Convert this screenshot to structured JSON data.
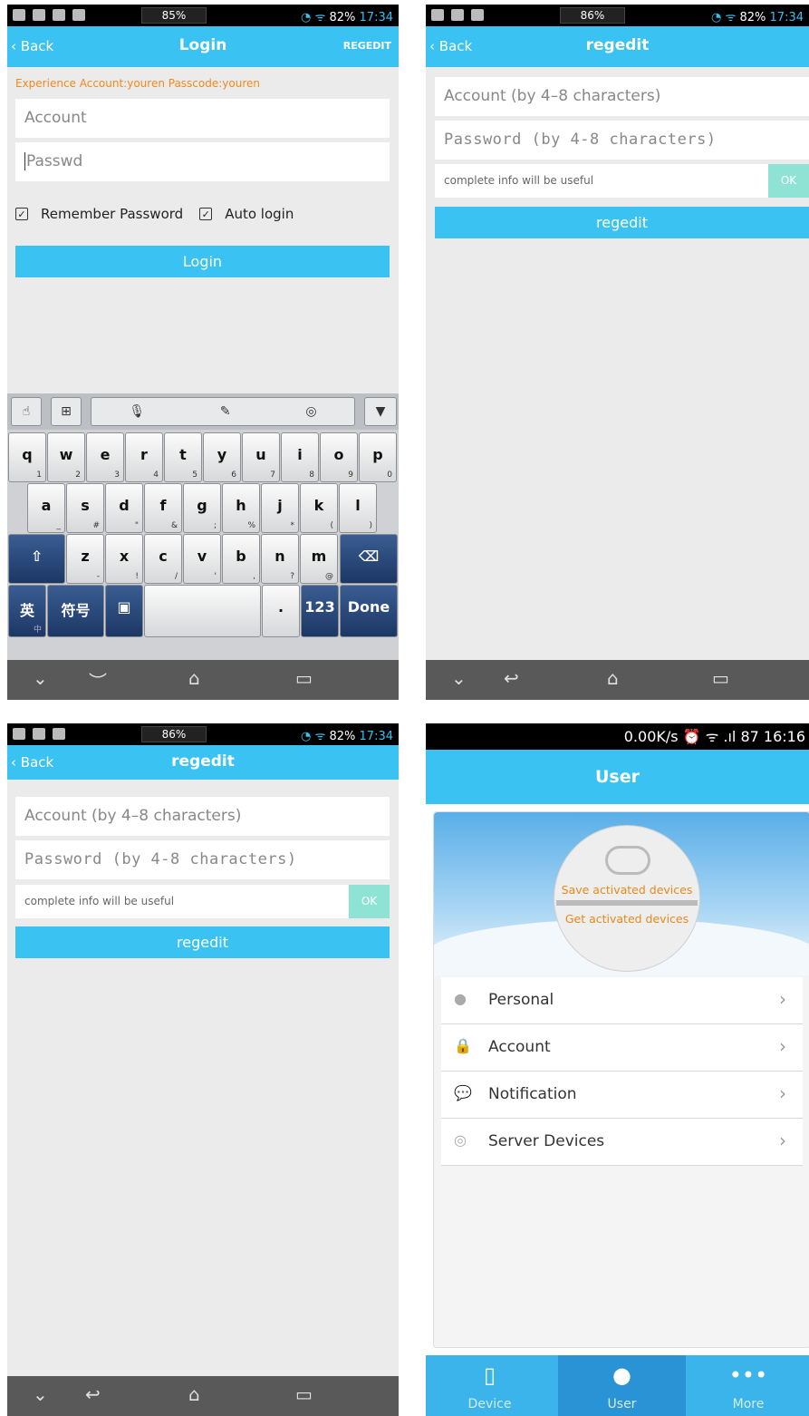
{
  "panel1": {
    "status": {
      "battery": "85%",
      "right": "82%",
      "time": "17:34"
    },
    "back": "Back",
    "title": "Login",
    "right_action": "REGEDIT",
    "hint": "Experience Account:youren Passcode:youren",
    "account_placeholder": "Account",
    "password_placeholder": "Passwd",
    "remember": "Remember Password",
    "autologin": "Auto login",
    "login_button": "Login",
    "keyboard": {
      "row1": [
        {
          "k": "q",
          "s": "1"
        },
        {
          "k": "w",
          "s": "2"
        },
        {
          "k": "e",
          "s": "3"
        },
        {
          "k": "r",
          "s": "4"
        },
        {
          "k": "t",
          "s": "5"
        },
        {
          "k": "y",
          "s": "6"
        },
        {
          "k": "u",
          "s": "7"
        },
        {
          "k": "i",
          "s": "8"
        },
        {
          "k": "o",
          "s": "9"
        },
        {
          "k": "p",
          "s": "0"
        }
      ],
      "row2": [
        {
          "k": "a",
          "s": "_"
        },
        {
          "k": "s",
          "s": "#"
        },
        {
          "k": "d",
          "s": "\""
        },
        {
          "k": "f",
          "s": "&"
        },
        {
          "k": "g",
          "s": ";"
        },
        {
          "k": "h",
          "s": "%"
        },
        {
          "k": "j",
          "s": "*"
        },
        {
          "k": "k",
          "s": "("
        },
        {
          "k": "l",
          "s": ")"
        }
      ],
      "row3": [
        {
          "k": "z",
          "s": "-"
        },
        {
          "k": "x",
          "s": "!"
        },
        {
          "k": "c",
          "s": "/"
        },
        {
          "k": "v",
          "s": "'"
        },
        {
          "k": "b",
          "s": ","
        },
        {
          "k": "n",
          "s": "?"
        },
        {
          "k": "m",
          "s": "@"
        }
      ],
      "lang": "英",
      "lang_sub": "中",
      "symbols": "符号",
      "period": ".",
      "num": "123",
      "done": "Done"
    }
  },
  "panel2": {
    "status": {
      "battery": "86%",
      "right": "82%",
      "time": "17:34"
    },
    "back": "Back",
    "title": "regedit",
    "account_placeholder": "Account (by 4–8 characters)",
    "password_placeholder": "Password (by 4-8 characters)",
    "info_placeholder": "complete info will be useful",
    "ok": "OK",
    "regedit_button": "regedit"
  },
  "panel3": {
    "status": {
      "battery": "86%",
      "right": "82%",
      "time": "17:34"
    },
    "back": "Back",
    "title": "regedit",
    "account_placeholder": "Account (by 4–8 characters)",
    "password_placeholder": "Password (by 4-8 characters)",
    "info_placeholder": "complete info will be useful",
    "ok": "OK",
    "regedit_button": "regedit"
  },
  "panel4": {
    "status": "0.00K/s ⏰ ᯤ .ıl 87 16:16",
    "title": "User",
    "save": "Save activated devices",
    "get": "Get activated devices",
    "items": [
      {
        "label": "Personal",
        "icon": "person-icon"
      },
      {
        "label": "Account",
        "icon": "lock-icon"
      },
      {
        "label": "Notification",
        "icon": "chat-icon"
      },
      {
        "label": "Server Devices",
        "icon": "signal-icon"
      }
    ],
    "tabs": [
      {
        "label": "Device"
      },
      {
        "label": "User"
      },
      {
        "label": "More"
      }
    ]
  }
}
